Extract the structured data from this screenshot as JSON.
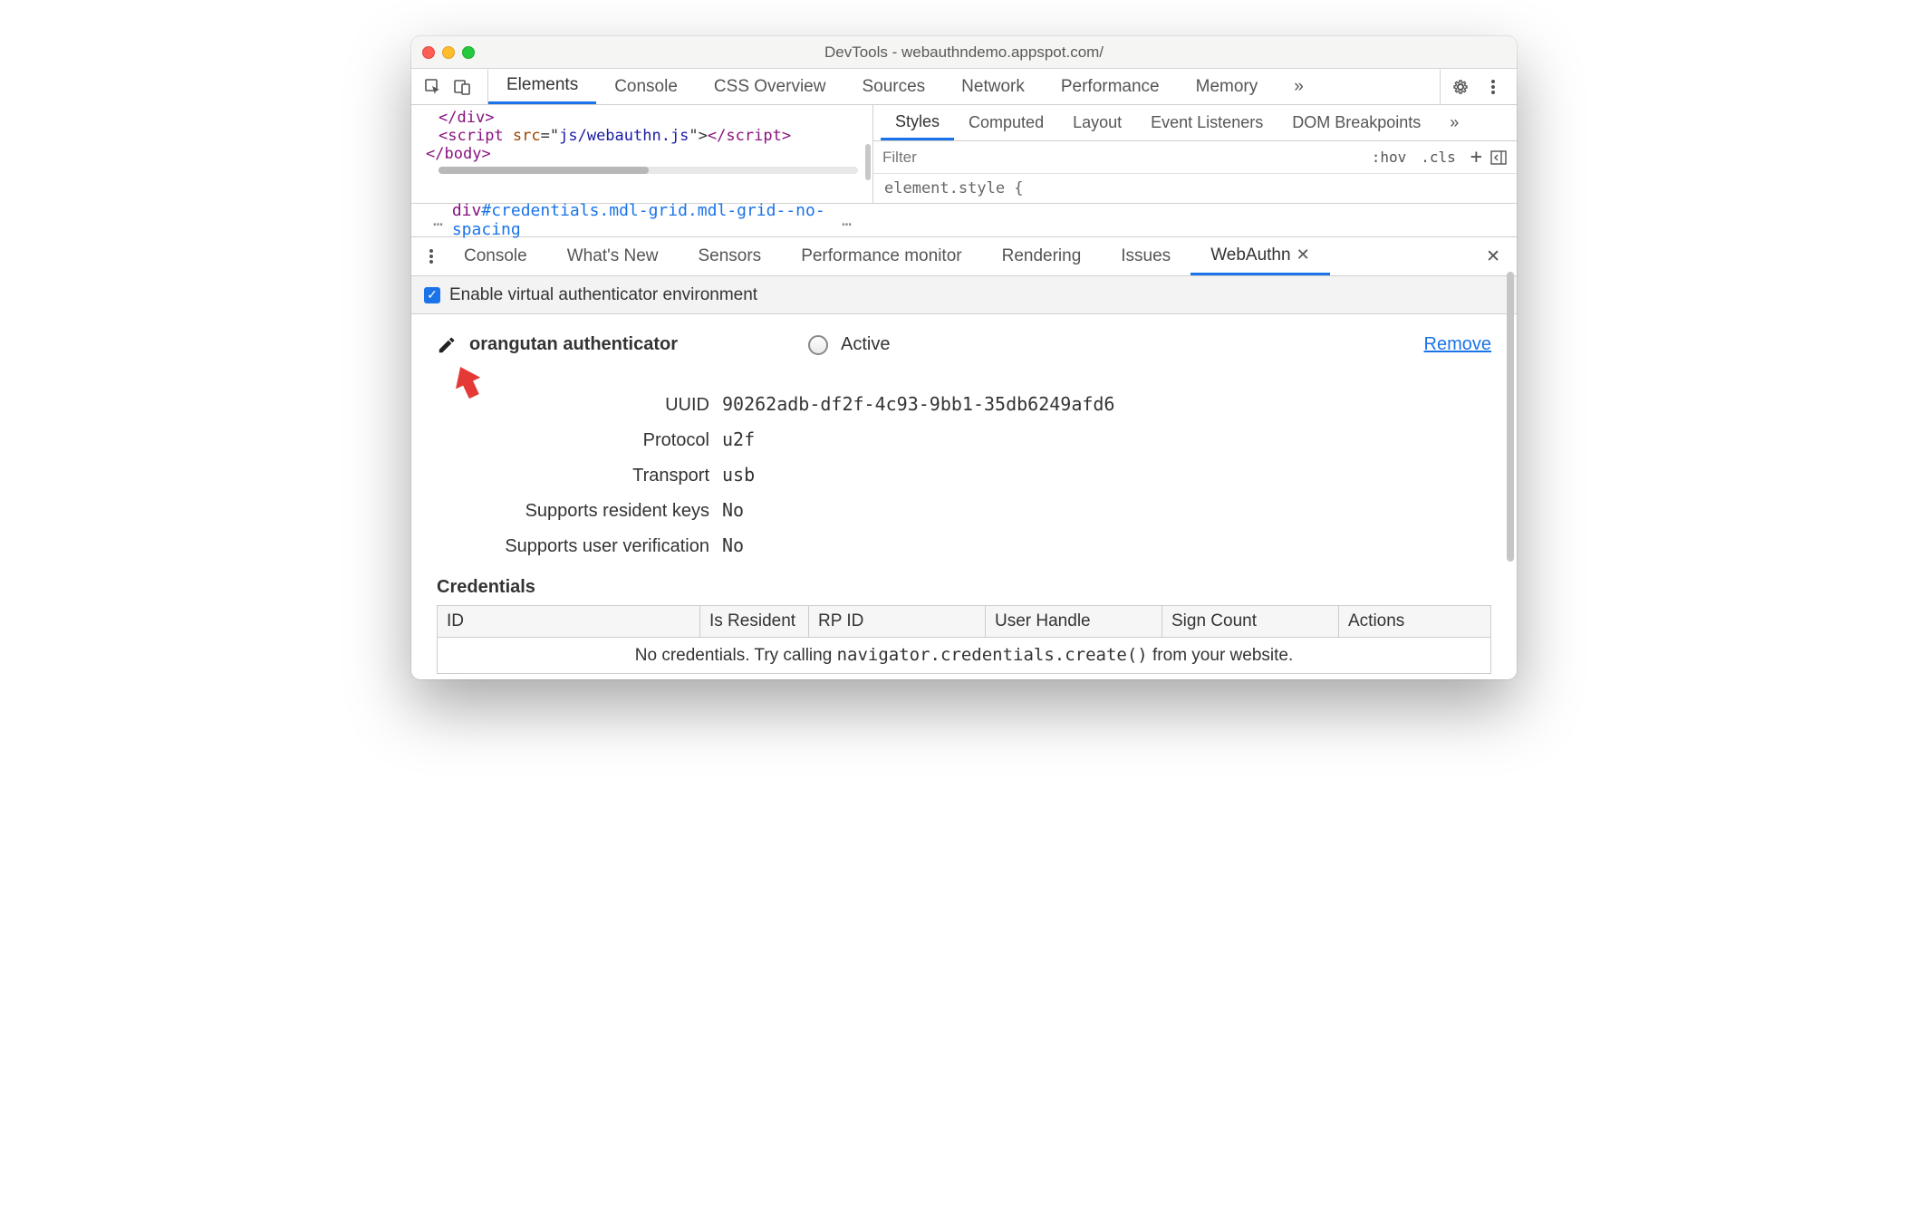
{
  "window": {
    "title": "DevTools - webauthndemo.appspot.com/"
  },
  "main_tabs": {
    "items": [
      "Elements",
      "Console",
      "CSS Overview",
      "Sources",
      "Network",
      "Performance",
      "Memory"
    ],
    "active": "Elements",
    "more": "»"
  },
  "code": {
    "l1a": "</",
    "l1b": "div",
    "l1c": ">",
    "l2a": "<",
    "l2b": "script",
    "l2c": " ",
    "l2d": "src",
    "l2e": "=\"",
    "l2f": "js/webauthn.js",
    "l2g": "\">",
    "l2h": "</",
    "l2i": "script",
    "l2j": ">",
    "l3a": "</",
    "l3b": "body",
    "l3c": ">"
  },
  "styles_tabs": {
    "items": [
      "Styles",
      "Computed",
      "Layout",
      "Event Listeners",
      "DOM Breakpoints"
    ],
    "active": "Styles",
    "more": "»"
  },
  "styles_filter": {
    "placeholder": "Filter",
    "hov": ":hov",
    "cls": ".cls",
    "plus": "+"
  },
  "styles_body": "element.style {",
  "breadcrumb": {
    "pre": "…",
    "sel": "div",
    "id": "#credentials",
    "cls": ".mdl-grid.mdl-grid--no-spacing",
    "post": "…"
  },
  "drawer_tabs": {
    "items": [
      "Console",
      "What's New",
      "Sensors",
      "Performance monitor",
      "Rendering",
      "Issues",
      "WebAuthn"
    ],
    "active": "WebAuthn"
  },
  "enable": {
    "label": "Enable virtual authenticator environment",
    "checked": true
  },
  "authenticator": {
    "name": "orangutan authenticator",
    "active_label": "Active",
    "remove": "Remove",
    "props": [
      {
        "label": "UUID",
        "value": "90262adb-df2f-4c93-9bb1-35db6249afd6"
      },
      {
        "label": "Protocol",
        "value": "u2f"
      },
      {
        "label": "Transport",
        "value": "usb"
      },
      {
        "label": "Supports resident keys",
        "value": "No"
      },
      {
        "label": "Supports user verification",
        "value": "No"
      }
    ]
  },
  "credentials": {
    "heading": "Credentials",
    "columns": [
      "ID",
      "Is Resident",
      "RP ID",
      "User Handle",
      "Sign Count",
      "Actions"
    ],
    "empty_pre": "No credentials. Try calling ",
    "empty_code": "navigator.credentials.create()",
    "empty_post": " from your website."
  }
}
